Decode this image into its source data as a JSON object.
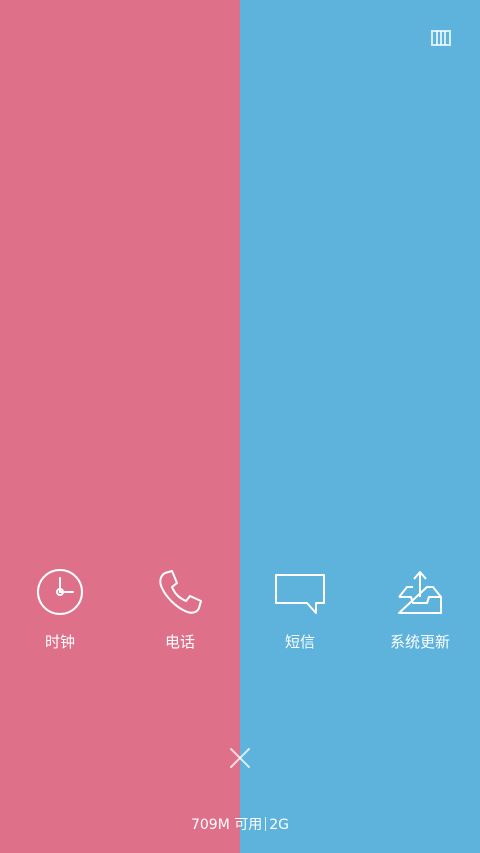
{
  "colors": {
    "left_pane": "#de7089",
    "right_pane": "#5db3db",
    "foreground": "#ffffff"
  },
  "shortcuts": [
    {
      "label": "时钟",
      "icon": "clock-icon"
    },
    {
      "label": "电话",
      "icon": "phone-icon"
    },
    {
      "label": "短信",
      "icon": "message-icon"
    },
    {
      "label": "系统更新",
      "icon": "system-update-icon"
    }
  ],
  "toolbar": {
    "layout_toggle_icon": "layout-toggle-icon",
    "close_icon": "close-icon"
  },
  "status": {
    "memory_free": "709M 可用",
    "memory_total": "2G"
  }
}
